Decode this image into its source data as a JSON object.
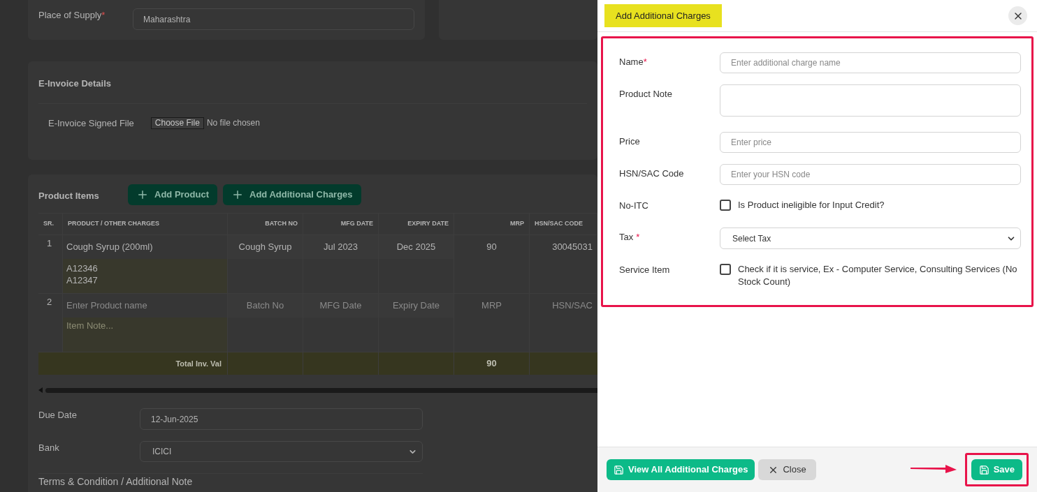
{
  "background": {
    "place_of_supply": {
      "label": "Place of Supply",
      "required_mark": "*",
      "value": "Maharashtra"
    },
    "e_invoice": {
      "title": "E-Invoice Details",
      "file_label": "E-Invoice Signed File",
      "file_button": "Choose File",
      "file_status": "No file chosen"
    },
    "product_items": {
      "title": "Product Items",
      "buttons": [
        {
          "label": "Add Product"
        },
        {
          "label": "Add Additional Charges"
        }
      ],
      "columns": [
        "SR.",
        "PRODUCT / OTHER CHARGES",
        "BATCH NO",
        "MFG DATE",
        "EXPIRY DATE",
        "MRP",
        "HSN/SAC CODE"
      ],
      "rows": [
        {
          "cells": [
            {
              "value": "1"
            },
            {
              "value": "Cough Syrup (200ml)",
              "note": {
                "value": "A12346\nA12347"
              }
            },
            {
              "value": "Cough Syrup"
            },
            {
              "value": "Jul 2023"
            },
            {
              "value": "Dec 2025"
            },
            {
              "value": "90"
            },
            {
              "value": "30045031"
            }
          ]
        },
        {
          "cells": [
            {
              "value": "2"
            },
            {
              "placeholder": "Enter Product name",
              "note": {
                "placeholder": "Item Note..."
              }
            },
            {
              "placeholder": "Batch No"
            },
            {
              "placeholder": "MFG Date"
            },
            {
              "placeholder": "Expiry Date"
            },
            {
              "placeholder": "MRP"
            },
            {
              "placeholder": "HSN/SAC"
            }
          ]
        }
      ],
      "total": {
        "label": "Total Inv. Val",
        "mrp": "90"
      }
    },
    "due_date": {
      "label": "Due Date",
      "value": "12-Jun-2025"
    },
    "bank": {
      "label": "Bank",
      "value": "ICICI"
    },
    "terms_title": "Terms & Condition / Additional Note"
  },
  "dialog": {
    "title": "Add Additional Charges",
    "fields": [
      {
        "kind": "text",
        "label": "Name",
        "required_mark": "*",
        "placeholder": "Enter additional charge name"
      },
      {
        "kind": "textarea",
        "label": "Product Note"
      },
      {
        "kind": "text",
        "label": "Price",
        "placeholder": "Enter price"
      },
      {
        "kind": "text",
        "label": "HSN/SAC Code",
        "placeholder": "Enter your HSN code"
      },
      {
        "kind": "checkbox",
        "label": "No-ITC",
        "text": "Is Product ineligible for Input Credit?",
        "checked": false
      },
      {
        "kind": "select",
        "label": "Tax",
        "required_mark": "*",
        "value": "Select Tax"
      },
      {
        "kind": "checkbox",
        "label": "Service Item",
        "text": "Check if it is service, Ex - Computer Service, Consulting Services (No Stock Count)",
        "checked": false
      }
    ],
    "footer_buttons": [
      {
        "kind": "primary",
        "label": "View All Additional Charges"
      },
      {
        "kind": "secondary",
        "label": "Close"
      }
    ],
    "save_button": {
      "label": "Save"
    }
  }
}
